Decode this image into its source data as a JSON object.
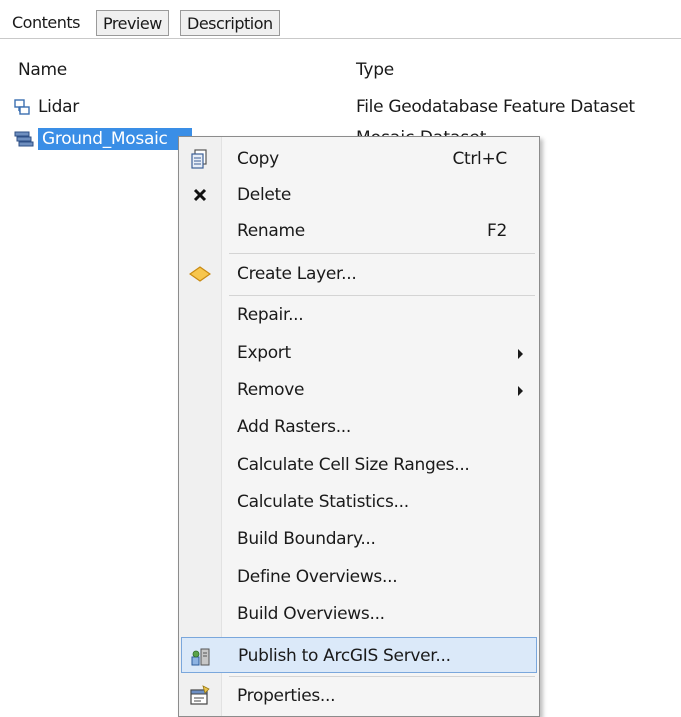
{
  "tabs": {
    "contents": "Contents",
    "preview": "Preview",
    "description": "Description"
  },
  "columns": {
    "name": "Name",
    "type": "Type"
  },
  "rows": [
    {
      "name": "Lidar",
      "type": "File Geodatabase Feature Dataset",
      "icon": "feature-dataset-icon"
    },
    {
      "name": "Ground_Mosaic",
      "type": "Mosaic Dataset",
      "icon": "mosaic-dataset-icon",
      "selected": true
    }
  ],
  "menu": {
    "items": [
      {
        "label": "Copy",
        "shortcut": "Ctrl+C",
        "icon": "copy-icon"
      },
      {
        "label": "Delete",
        "shortcut": "",
        "icon": "delete-icon"
      },
      {
        "label": "Rename",
        "shortcut": "F2",
        "icon": ""
      },
      {
        "label": "Create Layer...",
        "shortcut": "",
        "icon": "layer-diamond-icon"
      },
      {
        "label": "Repair...",
        "shortcut": "",
        "icon": ""
      },
      {
        "label": "Export",
        "shortcut": "",
        "icon": "",
        "submenu": true
      },
      {
        "label": "Remove",
        "shortcut": "",
        "icon": "",
        "submenu": true
      },
      {
        "label": "Add Rasters...",
        "shortcut": "",
        "icon": ""
      },
      {
        "label": "Calculate Cell Size Ranges...",
        "shortcut": "",
        "icon": ""
      },
      {
        "label": "Calculate Statistics...",
        "shortcut": "",
        "icon": ""
      },
      {
        "label": "Build Boundary...",
        "shortcut": "",
        "icon": ""
      },
      {
        "label": "Define Overviews...",
        "shortcut": "",
        "icon": ""
      },
      {
        "label": "Build Overviews...",
        "shortcut": "",
        "icon": ""
      },
      {
        "label": "Publish to ArcGIS Server...",
        "shortcut": "",
        "icon": "publish-server-icon",
        "highlighted": true
      },
      {
        "label": "Properties...",
        "shortcut": "",
        "icon": "properties-icon"
      }
    ]
  },
  "colors": {
    "selection": "#3a8ee6",
    "menu_highlight": "#dbe9f9",
    "menu_highlight_border": "#7aa7dc"
  }
}
